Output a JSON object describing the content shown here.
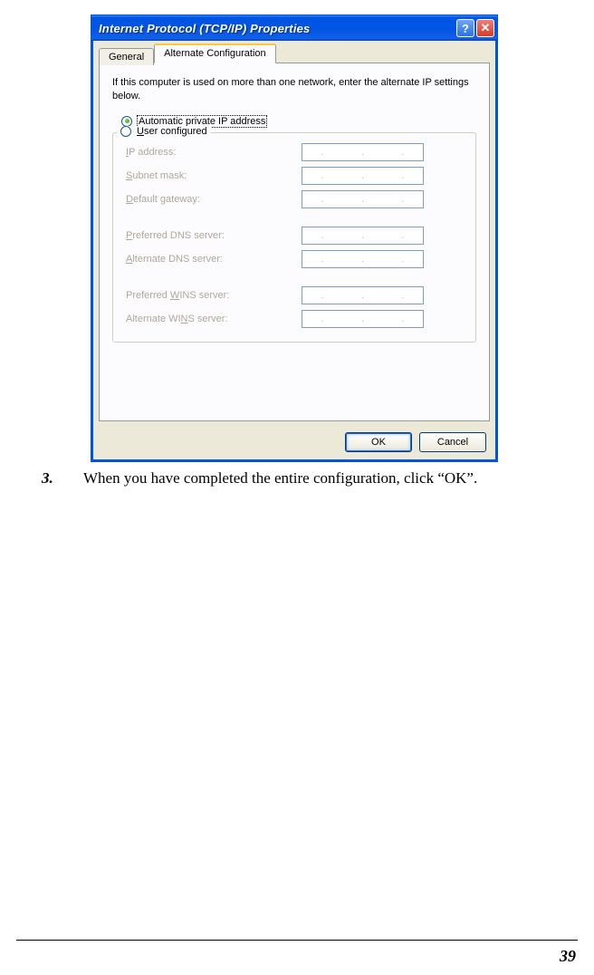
{
  "dialog": {
    "title": "Internet Protocol (TCP/IP) Properties",
    "tabs": {
      "general": "General",
      "alternate": "Alternate Configuration"
    },
    "instruction": "If this computer is used on more than one network, enter the alternate IP settings below.",
    "radio1": "Automatic private IP address",
    "radio2_prefix": "U",
    "radio2_rest": "ser configured",
    "fields": {
      "ip_prefix": "I",
      "ip_rest": "P address:",
      "subnet_prefix": "S",
      "subnet_rest": "ubnet mask:",
      "gateway_prefix": "D",
      "gateway_rest": "efault gateway:",
      "pdns_prefix": "P",
      "pdns_rest": "referred DNS server:",
      "adns_prefix": "A",
      "adns_rest": "lternate DNS server:",
      "pwins_pre": "Preferred ",
      "pwins_u": "W",
      "pwins_post": "INS server:",
      "awins_pre": "Alternate WI",
      "awins_u": "N",
      "awins_post": "S server:"
    },
    "buttons": {
      "ok": "OK",
      "cancel": "Cancel"
    }
  },
  "doc": {
    "step_num": "3.",
    "step_text": "When you have completed the entire configuration, click “OK”.",
    "page_number": "39"
  }
}
